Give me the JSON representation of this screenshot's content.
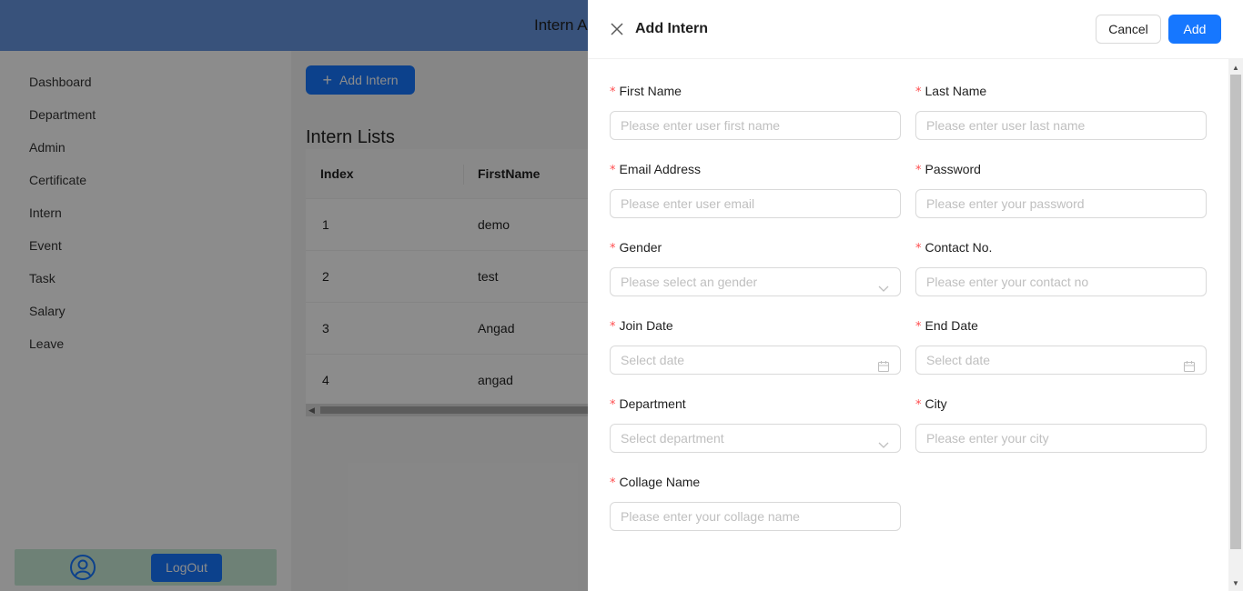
{
  "app": {
    "title": "Intern Admin",
    "sidebar": {
      "items": [
        {
          "label": "Dashboard"
        },
        {
          "label": "Department"
        },
        {
          "label": "Admin"
        },
        {
          "label": "Certificate"
        },
        {
          "label": "Intern"
        },
        {
          "label": "Event"
        },
        {
          "label": "Task"
        },
        {
          "label": "Salary"
        },
        {
          "label": "Leave"
        }
      ],
      "footer": {
        "avatar_icon": "user-circle-icon",
        "logout_label": "LogOut"
      }
    },
    "main": {
      "add_button_label": "Add Intern",
      "list_title": "Intern Lists",
      "table": {
        "columns": [
          "Index",
          "FirstName"
        ],
        "rows": [
          {
            "index": "1",
            "first_name": "demo"
          },
          {
            "index": "2",
            "first_name": "test"
          },
          {
            "index": "3",
            "first_name": "Angad"
          },
          {
            "index": "4",
            "first_name": "angad"
          }
        ]
      }
    }
  },
  "drawer": {
    "title": "Add Intern",
    "cancel_label": "Cancel",
    "add_label": "Add",
    "required_mark": "*",
    "fields": {
      "first_name": {
        "label": "First Name",
        "placeholder": "Please enter user first name"
      },
      "last_name": {
        "label": "Last Name",
        "placeholder": "Please enter user last name"
      },
      "email": {
        "label": "Email Address",
        "placeholder": "Please enter user email"
      },
      "password": {
        "label": "Password",
        "placeholder": "Please enter your password"
      },
      "gender": {
        "label": "Gender",
        "placeholder": "Please select an gender"
      },
      "contact": {
        "label": "Contact No.",
        "placeholder": "Please enter your contact no"
      },
      "join_date": {
        "label": "Join Date",
        "placeholder": "Select date"
      },
      "end_date": {
        "label": "End Date",
        "placeholder": "Select date"
      },
      "department": {
        "label": "Department",
        "placeholder": "Select department"
      },
      "city": {
        "label": "City",
        "placeholder": "Please enter your city"
      },
      "collage_name": {
        "label": "Collage Name",
        "placeholder": "Please enter your collage name"
      }
    }
  },
  "colors": {
    "primary": "#1677ff",
    "required": "#ff4d4f",
    "header": "#6696e0"
  }
}
